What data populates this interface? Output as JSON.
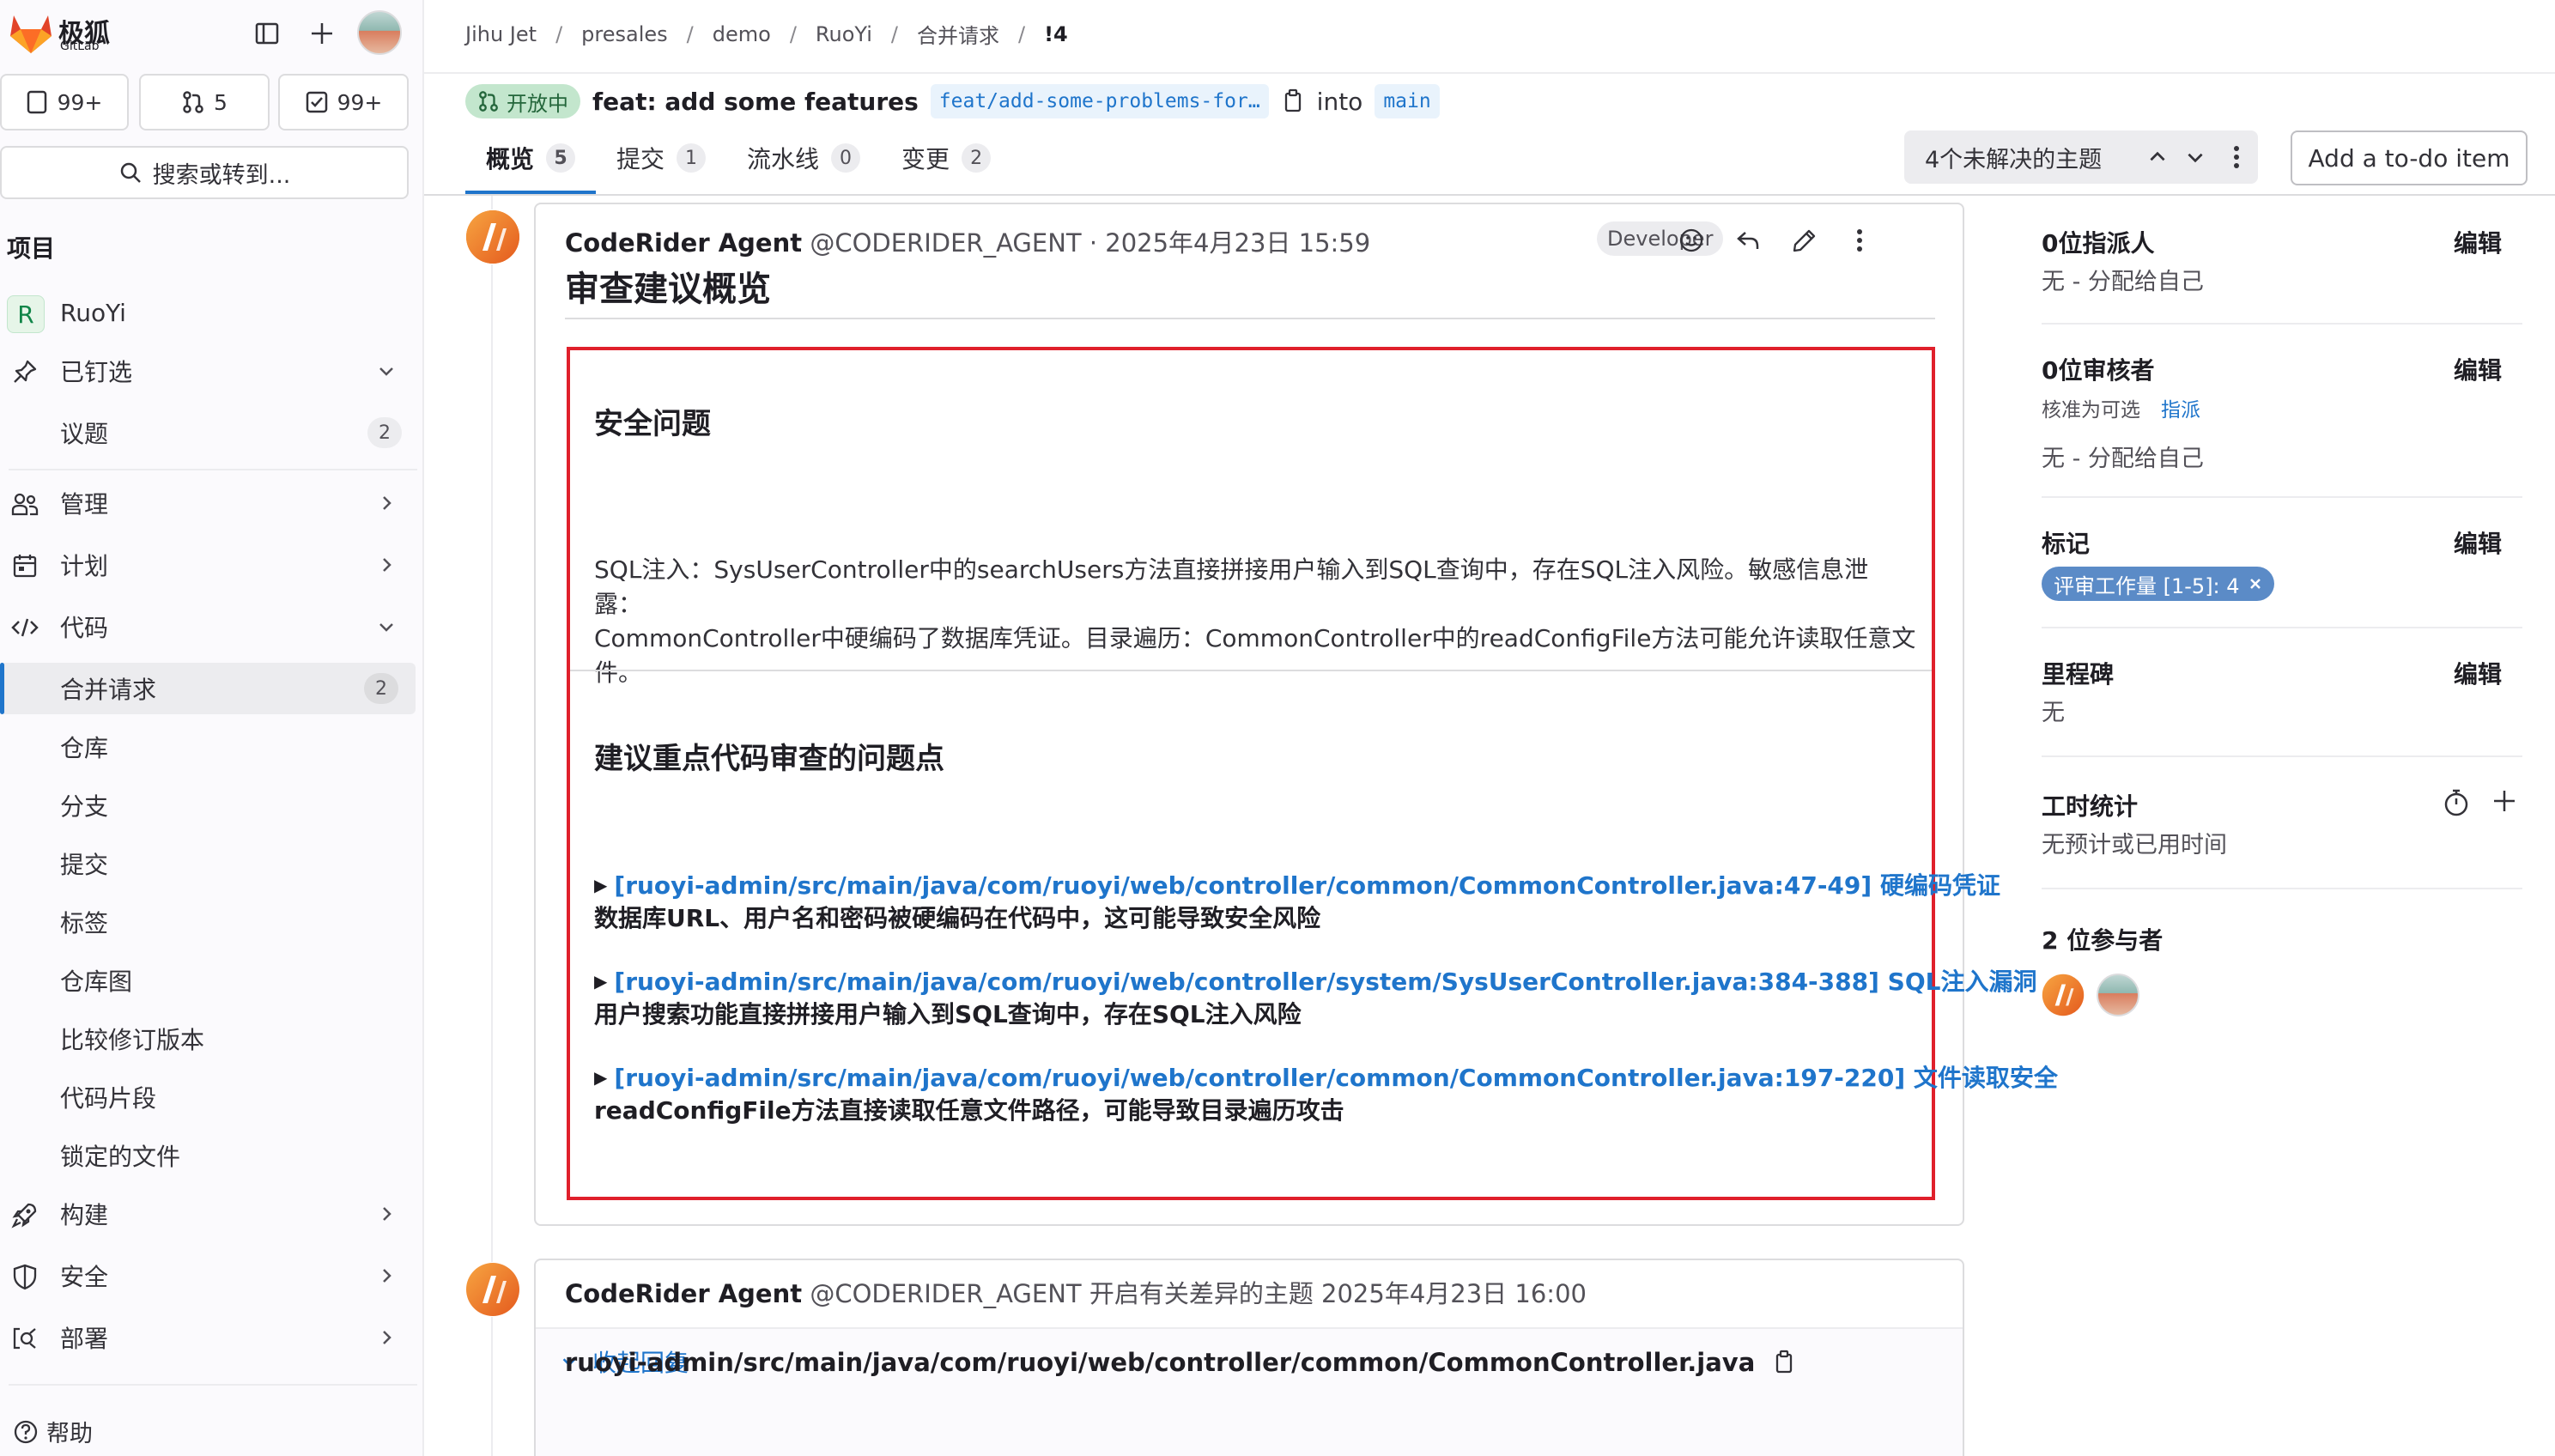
{
  "app": {
    "logo_cn": "极狐",
    "logo_en": "GitLab"
  },
  "sidebar": {
    "counters": [
      {
        "value": "99+"
      },
      {
        "value": "5"
      },
      {
        "value": "99+"
      }
    ],
    "search_label": "搜索或转到...",
    "section": "项目",
    "project": {
      "initial": "R",
      "name": "RuoYi"
    },
    "items": [
      {
        "label": "已钉选"
      },
      {
        "label": "议题",
        "badge": "2"
      },
      {
        "label": "管理"
      },
      {
        "label": "计划"
      },
      {
        "label": "代码"
      },
      {
        "label": "合并请求",
        "badge": "2"
      },
      {
        "label": "仓库"
      },
      {
        "label": "分支"
      },
      {
        "label": "提交"
      },
      {
        "label": "标签"
      },
      {
        "label": "仓库图"
      },
      {
        "label": "比较修订版本"
      },
      {
        "label": "代码片段"
      },
      {
        "label": "锁定的文件"
      },
      {
        "label": "构建"
      },
      {
        "label": "安全"
      },
      {
        "label": "部署"
      }
    ],
    "help": "帮助"
  },
  "breadcrumb": [
    "Jihu Jet",
    "presales",
    "demo",
    "RuoYi",
    "合并请求",
    "!4"
  ],
  "mr": {
    "status": "开放中",
    "title": "feat: add some features",
    "source_branch": "feat/add-some-problems-for…",
    "into": "into",
    "target_branch": "main"
  },
  "tabs": [
    {
      "label": "概览",
      "count": "5"
    },
    {
      "label": "提交",
      "count": "1"
    },
    {
      "label": "流水线",
      "count": "0"
    },
    {
      "label": "变更",
      "count": "2"
    }
  ],
  "threads": {
    "label": "4个未解决的主题"
  },
  "todo_button": "Add a to-do item",
  "note1": {
    "author": "CodeRider Agent",
    "meta": "@CODERIDER_AGENT · 2025年4月23日 15:59",
    "role": "Developer",
    "heading": "审查建议概览",
    "section1_title": "安全问题",
    "section1_lines": [
      "SQL注入：SysUserController中的searchUsers方法直接拼接用户输入到SQL查询中，存在SQL注入风险。敏感信息泄露：",
      "CommonController中硬编码了数据库凭证。目录遍历：CommonController中的readConfigFile方法可能允许读取任意文",
      "件。"
    ],
    "section2_title": "建议重点代码审查的问题点",
    "issues": [
      {
        "link": "[ruoyi-admin/src/main/java/com/ruoyi/web/controller/common/CommonController.java:47-49] 硬编码凭证",
        "desc": "数据库URL、用户名和密码被硬编码在代码中，这可能导致安全风险"
      },
      {
        "link": "[ruoyi-admin/src/main/java/com/ruoyi/web/controller/system/SysUserController.java:384-388] SQL注入漏洞",
        "desc": "用户搜索功能直接拼接用户输入到SQL查询中，存在SQL注入风险"
      },
      {
        "link": "[ruoyi-admin/src/main/java/com/ruoyi/web/controller/common/CommonController.java:197-220] 文件读取安全",
        "desc": "readConfigFile方法直接读取任意文件路径，可能导致目录遍历攻击"
      }
    ]
  },
  "note2": {
    "author": "CodeRider Agent",
    "meta": "@CODERIDER_AGENT 开启有关差异的主题 2025年4月23日 16:00",
    "collapse_label": "收起回复",
    "file_path": "ruoyi-admin/src/main/java/com/ruoyi/web/controller/common/CommonController.java"
  },
  "right_sidebar": {
    "edit_label": "编辑",
    "assignees": {
      "title": "0位指派人",
      "value": "无 - 分配给自己"
    },
    "reviewers": {
      "title": "0位审核者",
      "sub": "核准为可选",
      "sub_link": "指派",
      "value": "无 - 分配给自己"
    },
    "labels": {
      "title": "标记",
      "label": "评审工作量 [1-5]: 4",
      "label_color": "#5b8bc7"
    },
    "milestone": {
      "title": "里程碑",
      "value": "无"
    },
    "time": {
      "title": "工时统计",
      "value": "无预计或已用时间"
    },
    "participants": {
      "title": "2 位参与者"
    }
  },
  "colors": {
    "accent": "#1f75cb",
    "highlight_border": "#e0202b",
    "open_status": "#c3e6cd"
  }
}
